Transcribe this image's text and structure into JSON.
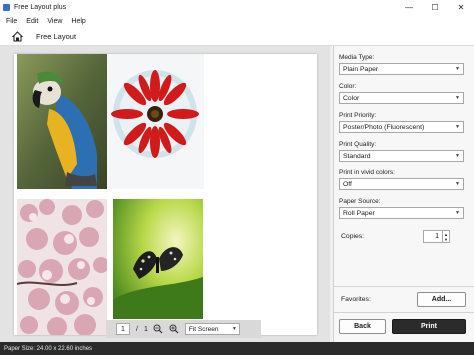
{
  "window": {
    "title": "Free Layout plus",
    "minimize_icon": "minimize-icon",
    "maximize_icon": "maximize-icon",
    "close_icon": "close-icon"
  },
  "menu": [
    "File",
    "Edit",
    "View",
    "Help"
  ],
  "toolbar": {
    "home_icon": "home-icon",
    "layout_name": "Free Layout"
  },
  "photos": [
    {
      "subject": "macaw parrot"
    },
    {
      "subject": "red gerbera flower in glass bowl"
    },
    {
      "subject": "pink cherry blossoms"
    },
    {
      "subject": "butterfly on leaf"
    }
  ],
  "page_nav": {
    "current_page": "1",
    "separator": "/",
    "total_pages": "1",
    "zoom_out_icon": "zoom-out-icon",
    "zoom_in_icon": "zoom-in-icon",
    "zoom_value": "Fit Screen"
  },
  "settings": {
    "media_type_label": "Media Type:",
    "media_type_value": "Plain Paper",
    "color_label": "Color:",
    "color_value": "Color",
    "print_priority_label": "Print Priority:",
    "print_priority_value": "Poster/Photo (Fluorescent)",
    "print_quality_label": "Print Quality:",
    "print_quality_value": "Standard",
    "vivid_label": "Print in vivid colors:",
    "vivid_value": "Off",
    "paper_source_label": "Paper Source:",
    "paper_source_value": "Roll Paper",
    "copies_label": "Copies:",
    "copies_value": "1",
    "favorites_label": "Favorites:",
    "add_label": "Add...",
    "back_label": "Back",
    "print_label": "Print"
  },
  "status": {
    "paper_size": "Paper Size: 24.00 x 22.60 inches"
  },
  "colors": {
    "print_button": "#2b2b2b",
    "status_bar": "#2b2b2b",
    "app_icon": "#3a6fc4"
  }
}
